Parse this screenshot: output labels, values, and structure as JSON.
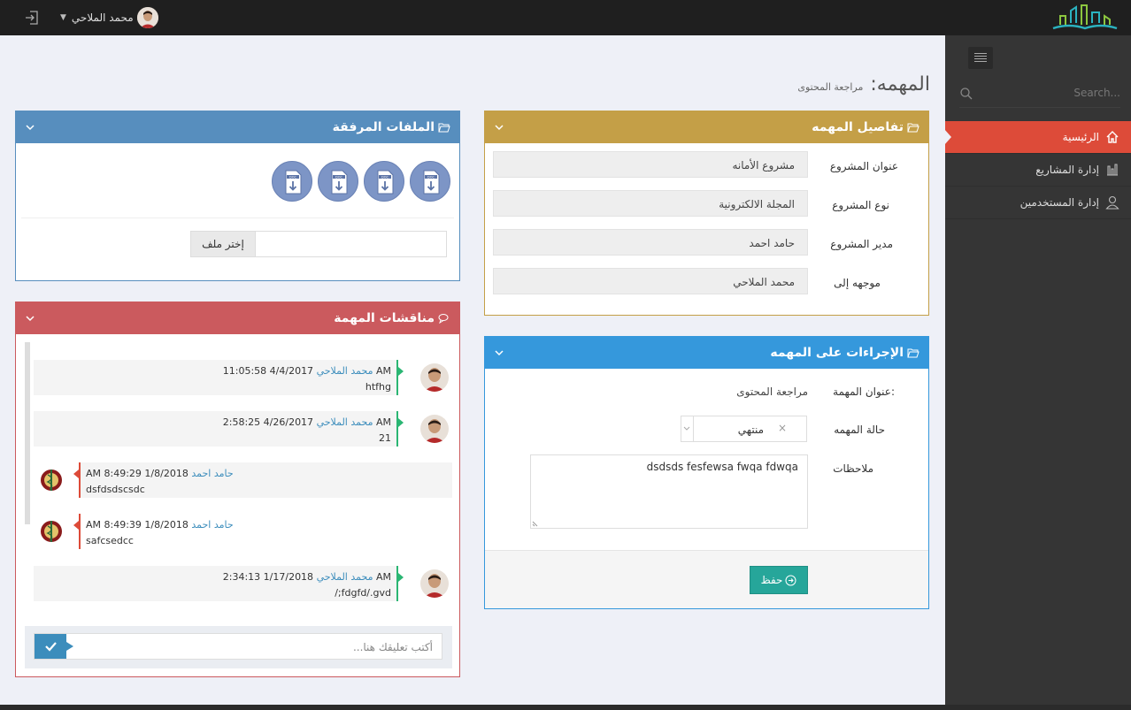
{
  "topbar": {
    "user_name": "محمد الملاحي"
  },
  "sidebar": {
    "search_placeholder": "Search...",
    "items": [
      {
        "label": "الرئيسية",
        "icon": "home-icon",
        "active": true
      },
      {
        "label": "إدارة المشاريع",
        "icon": "bar-chart-icon",
        "active": false
      },
      {
        "label": "إدارة المستخدمين",
        "icon": "user-icon",
        "active": false
      }
    ]
  },
  "page": {
    "title": "المهمه:",
    "subtitle": "مراجعة المحتوى"
  },
  "task_details": {
    "title": "تفاصيل المهمه",
    "color": "#c49f47",
    "fields": [
      {
        "label": "عنوان المشروع",
        "value": "مشروع الأمانه"
      },
      {
        "label": "نوع المشروع",
        "value": "المجلة الالكترونية"
      },
      {
        "label": "مدير المشروع",
        "value": "حامد احمد"
      },
      {
        "label": "موجهه إلى",
        "value": "محمد الملاحي"
      }
    ]
  },
  "task_actions": {
    "title": "الإجراءات على المهمه",
    "color": "#3598dc",
    "task_title_label": "عنوان المهمة:",
    "task_title_value": "مراجعة المحتوى",
    "status_label": "حالة المهمه",
    "status_value": "منتهي",
    "status_clear": "×",
    "notes_label": "ملاحظات",
    "notes_value": "dsdsds fesfewsa fwqa fdwqa",
    "save_label": "حفظ"
  },
  "attachments": {
    "title": "الملفات المرفقة",
    "color": "#578ebe",
    "doc_label": "DOC",
    "doc_count": 4,
    "choose_file_label": "إختر ملف"
  },
  "discussion": {
    "title": "مناقشات المهمة",
    "color": "#cb5a5e",
    "comment_placeholder": "أكتب تعليقك هنا...",
    "messages": [
      {
        "author": "محمد الملاحي",
        "time": "4/4/2017 11:05:58 AM",
        "body": "htfhg",
        "side": "right"
      },
      {
        "author": "محمد الملاحي",
        "time": "4/26/2017 2:58:25 AM",
        "body": "21",
        "side": "right"
      },
      {
        "author": "حامد احمد",
        "time": "1/8/2018 8:49:29 AM",
        "body": "dsfdsdscsdc",
        "side": "left"
      },
      {
        "author": "حامد احمد",
        "time": "1/8/2018 8:49:39 AM",
        "body": "safcsedcc",
        "side": "left"
      },
      {
        "author": "محمد الملاحي",
        "time": "1/17/2018 2:34:13 AM",
        "body": "/;fdgfd/.gvd",
        "side": "right"
      }
    ]
  }
}
